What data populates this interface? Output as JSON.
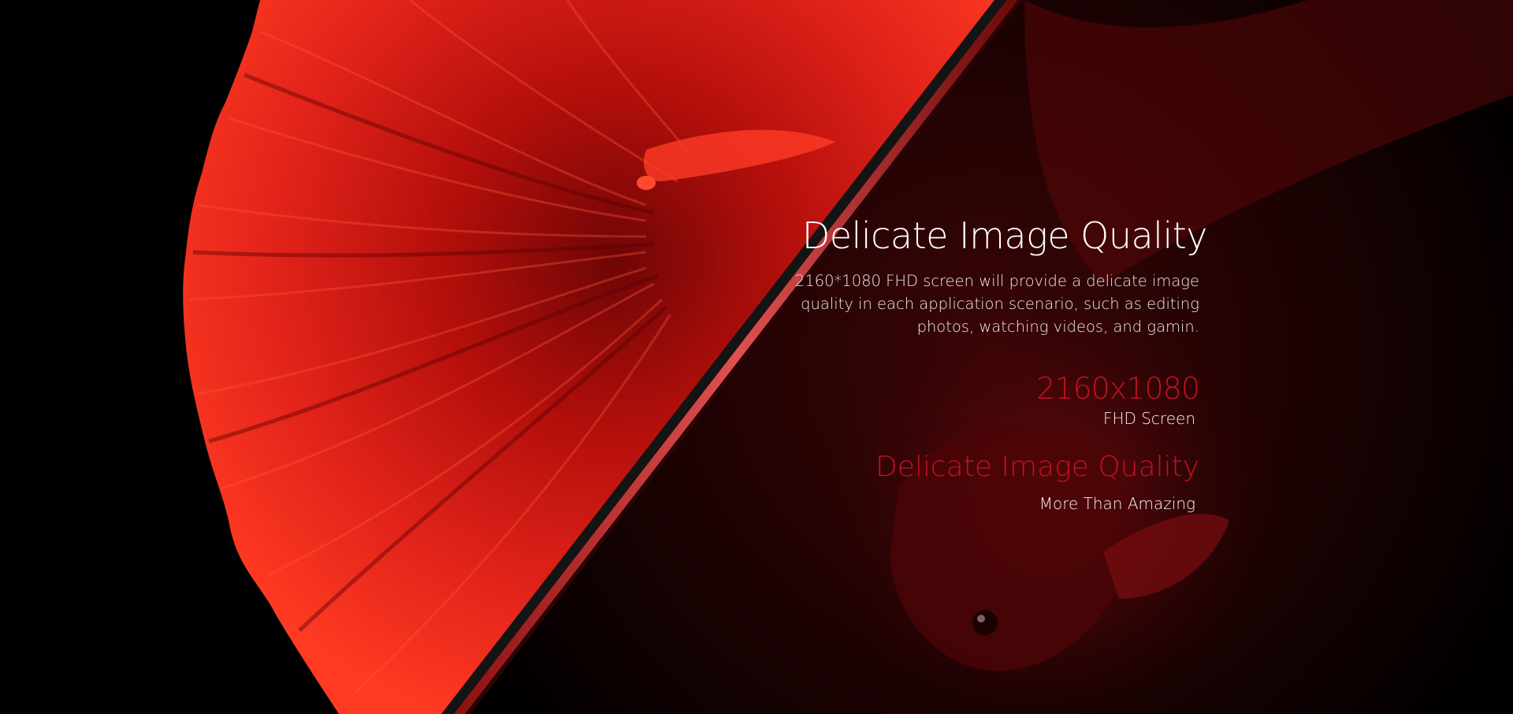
{
  "hero": {
    "headline": "Delicate Image Quality",
    "description": "2160*1080 FHD screen will provide a delicate image quality in each application scenario, such as editing photos, watching videos, and gamin.",
    "spec_value": "2160x1080",
    "spec_label": "FHD Screen",
    "tagline_title": "Delicate Image Quality",
    "tagline_sub": "More Than Amazing"
  },
  "colors": {
    "background": "#000000",
    "fin_red": "#e41d14",
    "accent_red": "#c1121f",
    "phone_edge": "#1c1c1c",
    "text": "#ffffff"
  },
  "icons": {
    "artwork": "betta-fish-phone-illustration"
  }
}
